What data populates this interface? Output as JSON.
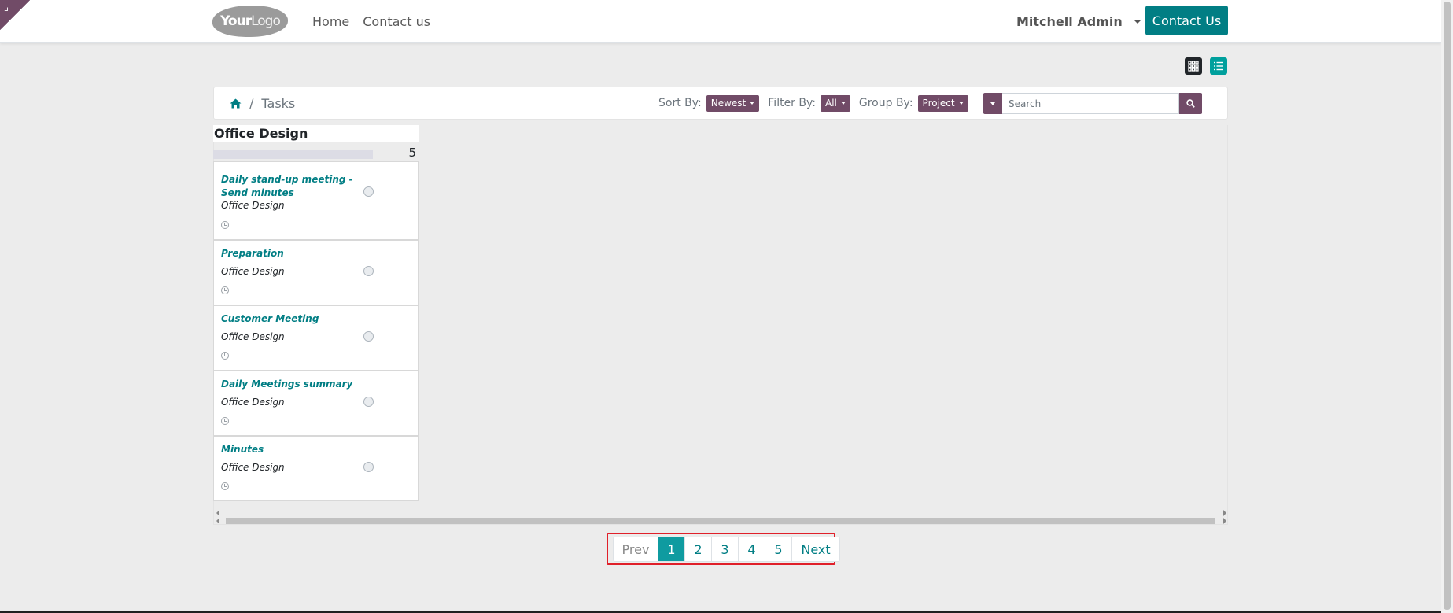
{
  "corner": {
    "glyph": "⌟"
  },
  "header": {
    "logo": {
      "bold": "Your",
      "light": "Logo"
    },
    "nav": [
      "Home",
      "Contact us"
    ],
    "user": "Mitchell Admin",
    "cta": "Contact Us"
  },
  "breadcrumb": {
    "current": "Tasks"
  },
  "controls": {
    "sort_label": "Sort By:",
    "sort_value": "Newest",
    "filter_label": "Filter By:",
    "filter_value": "All",
    "group_label": "Group By:",
    "group_value": "Project",
    "search_placeholder": "Search"
  },
  "column": {
    "title": "Office Design",
    "count": "5",
    "cards": [
      {
        "title": "Daily stand-up meeting - Send minutes",
        "project": "Office Design"
      },
      {
        "title": "Preparation",
        "project": "Office Design"
      },
      {
        "title": "Customer Meeting",
        "project": "Office Design"
      },
      {
        "title": "Daily Meetings summary",
        "project": "Office Design"
      },
      {
        "title": "Minutes",
        "project": "Office Design"
      }
    ]
  },
  "pagination": {
    "prev": "Prev",
    "pages": [
      "1",
      "2",
      "3",
      "4",
      "5"
    ],
    "active": "1",
    "next": "Next"
  },
  "colors": {
    "brand": "#714b67",
    "primary": "#017e84",
    "active_page": "#0f9ba0",
    "highlight_box": "#e0202a"
  }
}
